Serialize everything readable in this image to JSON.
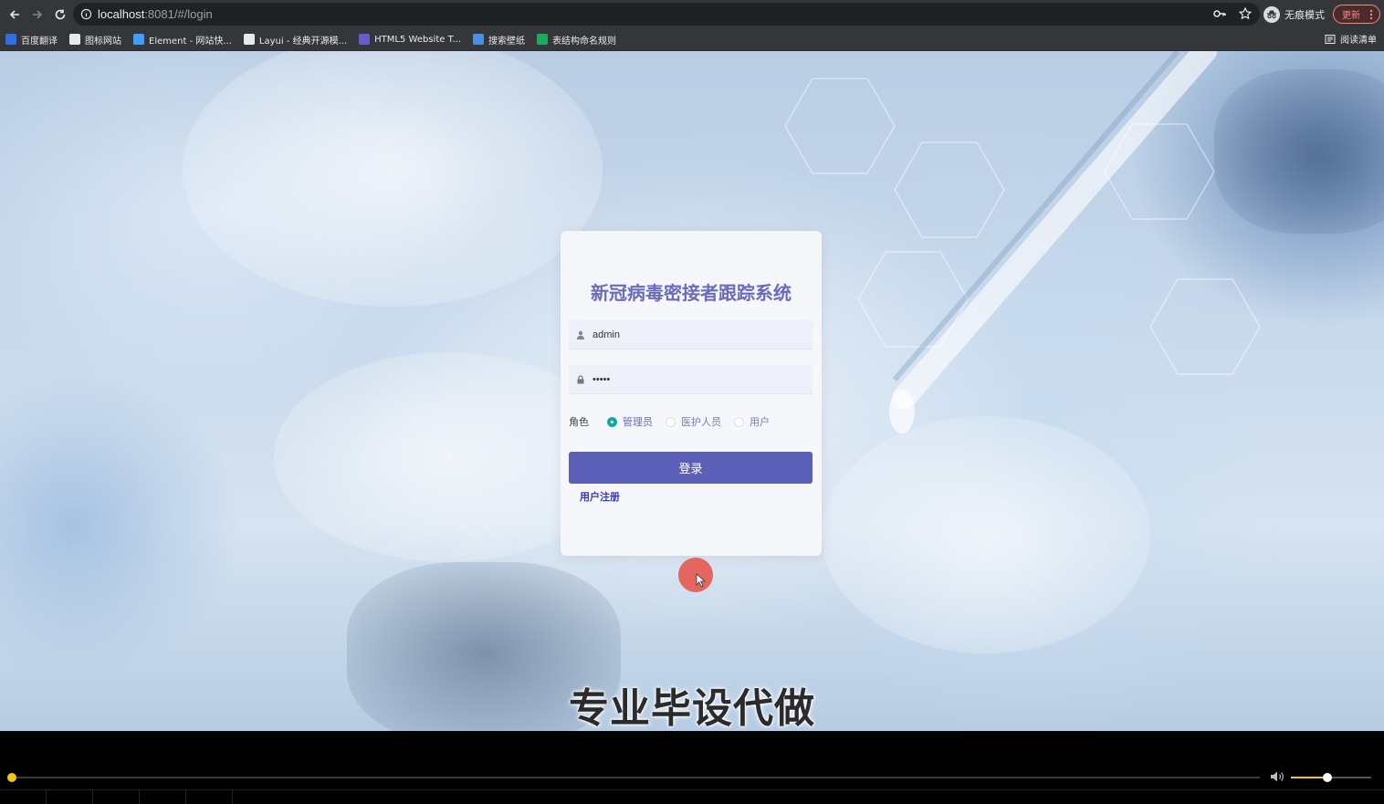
{
  "browser": {
    "url_host": "localhost",
    "url_path": ":8081/#/login",
    "incognito_label": "无痕模式",
    "update_label": "更新",
    "bookmarks": [
      {
        "label": "百度翻译",
        "color": "#2f6fe4"
      },
      {
        "label": "图标网站",
        "color": "#e8eaed"
      },
      {
        "label": "Element - 网站快...",
        "color": "#409eff"
      },
      {
        "label": "Layui - 经典开源模...",
        "color": "#e8eaed"
      },
      {
        "label": "HTML5 Website T...",
        "color": "#6a5acd"
      },
      {
        "label": "搜索壁纸",
        "color": "#4a90e2"
      },
      {
        "label": "表结构命名规则",
        "color": "#1aab5c"
      }
    ],
    "reading_list_label": "阅读清单"
  },
  "login": {
    "title": "新冠病毒密接者跟踪系统",
    "username_value": "admin",
    "password_value": "•••••",
    "role_label": "角色",
    "roles": [
      {
        "label": "管理员",
        "checked": true
      },
      {
        "label": "医护人员",
        "checked": false
      },
      {
        "label": "用户",
        "checked": false
      }
    ],
    "login_button": "登录",
    "register_link": "用户注册",
    "accent_color": "#5b5fb8"
  },
  "overlay": {
    "subtitle": "专业毕设代做"
  },
  "player": {
    "progress": 0.0,
    "volume": 0.45,
    "accent_color": "#f5c518"
  }
}
